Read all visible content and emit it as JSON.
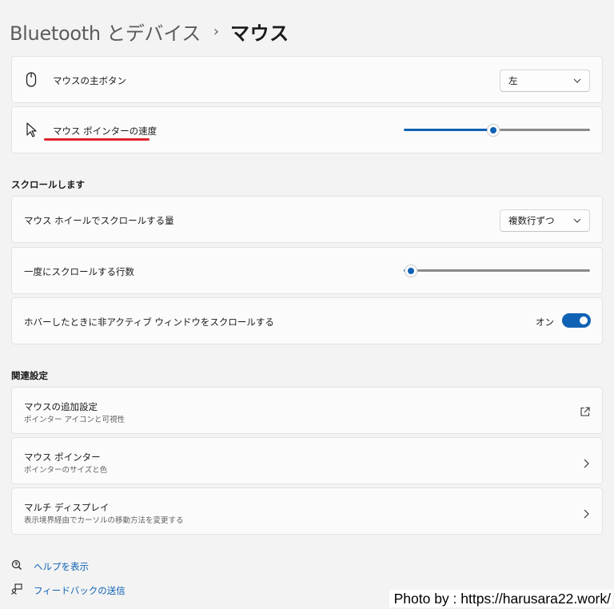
{
  "breadcrumb": {
    "parent": "Bluetooth とデバイス",
    "separator": "›",
    "current": "マウス"
  },
  "mouse_settings": {
    "primary_button": {
      "label": "マウスの主ボタン",
      "icon": "mouse-icon",
      "value": "左"
    },
    "pointer_speed": {
      "label": "マウス ポインターの速度",
      "icon": "pointer-icon",
      "value_fraction": 0.48
    }
  },
  "scroll_section": {
    "title": "スクロールします",
    "wheel_amount": {
      "label": "マウス ホイールでスクロールする量",
      "value": "複数行ずつ"
    },
    "lines": {
      "label": "一度にスクロールする行数",
      "value_fraction": 0.04
    },
    "inactive_scroll": {
      "label": "ホバーしたときに非アクティブ ウィンドウをスクロールする",
      "state": "オン",
      "on": true
    }
  },
  "related_section": {
    "title": "関連設定",
    "items": [
      {
        "title": "マウスの追加設定",
        "subtitle": "ポインター アイコンと可視性",
        "icon": "external-link-icon"
      },
      {
        "title": "マウス ポインター",
        "subtitle": "ポインターのサイズと色",
        "icon": "chevron-right-icon"
      },
      {
        "title": "マルチ ディスプレイ",
        "subtitle": "表示境界経由でカーソルの移動方法を変更する",
        "icon": "chevron-right-icon"
      }
    ]
  },
  "help_links": {
    "help": {
      "label": "ヘルプを表示",
      "icon": "help-icon"
    },
    "feedback": {
      "label": "フィードバックの送信",
      "icon": "feedback-icon"
    }
  },
  "credit": "Photo by : https://harusara22.work/",
  "colors": {
    "accent": "#0f62b4",
    "annotation": "#e0232b",
    "background": "#f3f3f3",
    "card": "#fbfbfb"
  }
}
